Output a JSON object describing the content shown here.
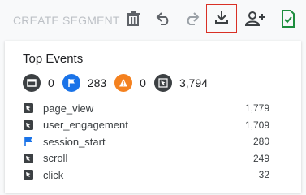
{
  "toolbar": {
    "create_segment_label": "CREATE SEGMENT",
    "icons": [
      "delete-icon",
      "undo-icon",
      "redo-icon",
      "download-icon",
      "add-user-icon",
      "check-doc-icon"
    ]
  },
  "panel": {
    "title": "Top Events",
    "summary": [
      {
        "icon": "page-icon",
        "color": "#3c4043",
        "count": "0"
      },
      {
        "icon": "flag-icon",
        "color": "#1a73e8",
        "count": "283"
      },
      {
        "icon": "warning-icon",
        "color": "#f4811f",
        "count": "0"
      },
      {
        "icon": "cursor-icon",
        "color": "#3c4043",
        "count": "3,794"
      }
    ],
    "events": [
      {
        "name": "page_view",
        "value": "1,779",
        "icon": "cursor-icon"
      },
      {
        "name": "user_engagement",
        "value": "1,709",
        "icon": "cursor-icon"
      },
      {
        "name": "session_start",
        "value": "280",
        "icon": "flag-icon"
      },
      {
        "name": "scroll",
        "value": "249",
        "icon": "cursor-icon"
      },
      {
        "name": "click",
        "value": "32",
        "icon": "cursor-icon"
      }
    ]
  },
  "colors": {
    "accent_blue": "#1a73e8",
    "warning_orange": "#f4811f",
    "check_green": "#1e8e3e",
    "highlight_red": "#d93025"
  }
}
